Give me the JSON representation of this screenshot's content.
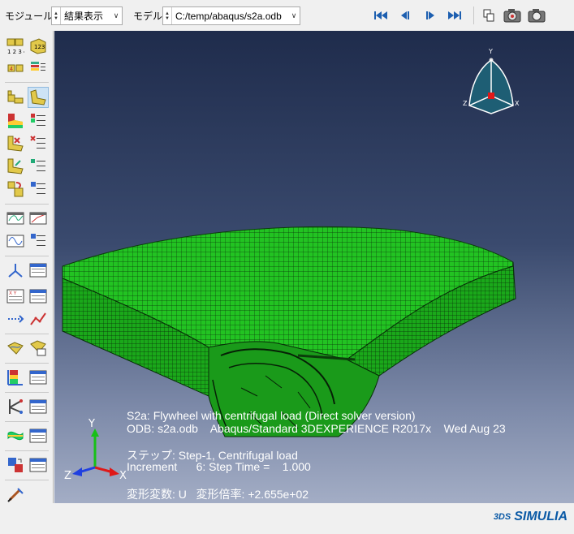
{
  "toolbar": {
    "module_label": "モジュール:",
    "module_value": "結果表示",
    "model_label": "モデル:",
    "model_value": "C:/temp/abaqus/s2a.odb",
    "playback": [
      "first-frame-icon",
      "previous-frame-icon",
      "next-frame-icon",
      "last-frame-icon"
    ],
    "view_tools": [
      "copy-viewport-icon",
      "capture-image-icon",
      "camera-icon"
    ]
  },
  "viewport": {
    "title_line": "S2a: Flywheel with centrifugal load (Direct solver version)",
    "odb_line": "ODB: s2a.odb    Abaqus/Standard 3DEXPERIENCE R2017x    Wed Aug 23",
    "step_line": "ステップ: Step-1, Centrifugal load",
    "increment_line": "Increment      6: Step Time =    1.000",
    "deform_line": "変形変数: U   変形倍率: +2.655e+02",
    "triad_front": {
      "x": "X",
      "y": "Y",
      "z": "Z"
    },
    "triad_view": {
      "x": "X",
      "y": "Y",
      "z": "Z"
    }
  },
  "brand": {
    "name": "SIMULIA",
    "mark": "3DS"
  },
  "colors": {
    "mesh_green": "#1fbf1f",
    "mesh_line": "#0a3a0a",
    "viewport_top": "#1f2c4c",
    "viewport_bottom": "#a3adc5"
  }
}
